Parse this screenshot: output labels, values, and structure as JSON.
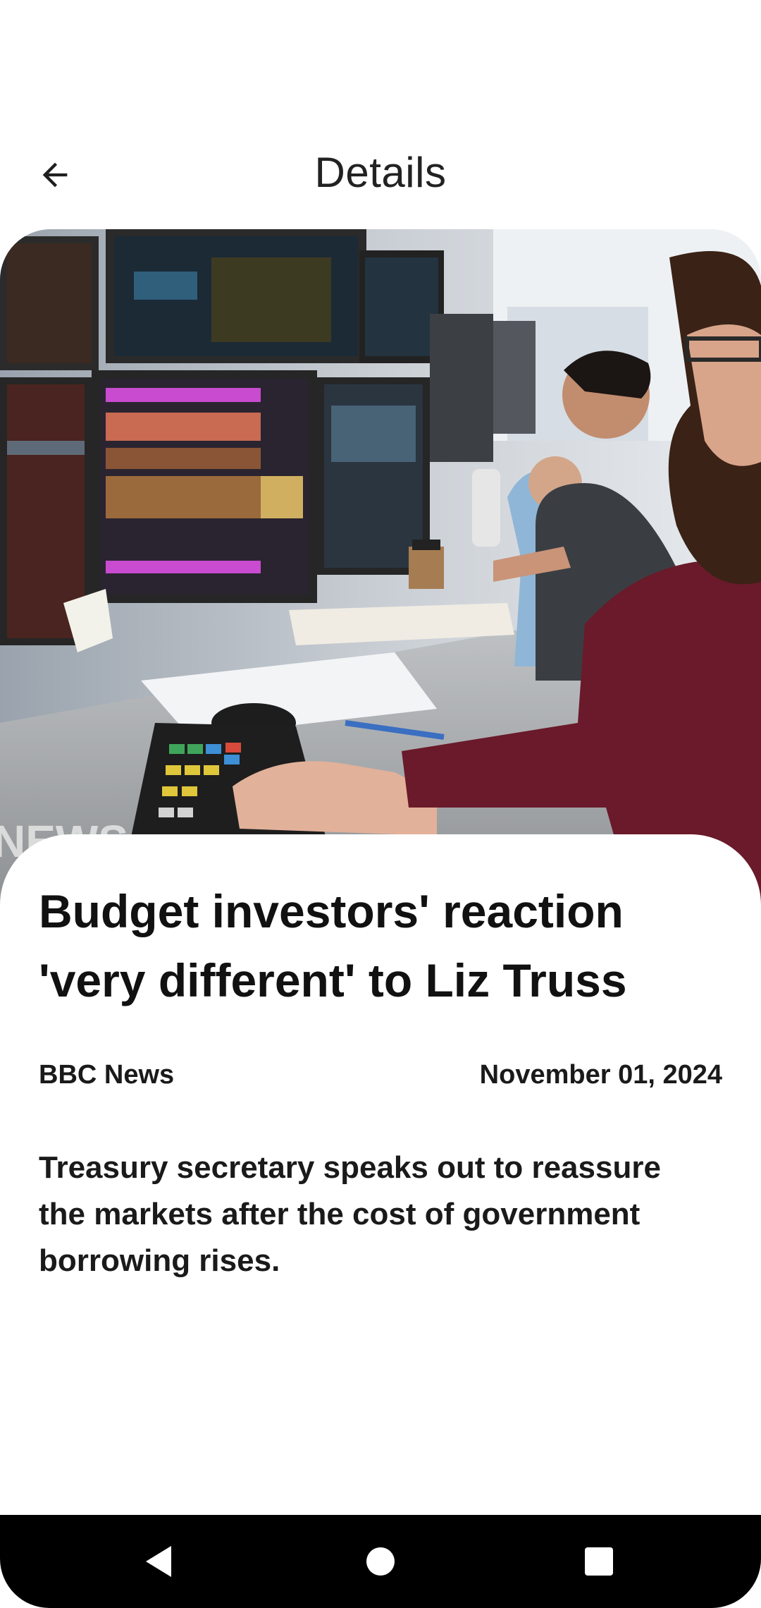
{
  "app_bar": {
    "title": "Details",
    "back_icon": "arrow-back-icon"
  },
  "hero_image": {
    "description_icon": "news-photo",
    "watermark": "NEWS"
  },
  "article": {
    "headline": "Budget investors' reaction 'very different' to Liz Truss",
    "source": "BBC News",
    "date": "November 01, 2024",
    "summary": "Treasury secretary speaks out to reassure the markets after the cost of government borrowing rises."
  },
  "system_nav": {
    "back_icon": "nav-back-icon",
    "home_icon": "nav-home-icon",
    "recents_icon": "nav-recents-icon"
  },
  "colors": {
    "background": "#ffffff",
    "text": "#111111",
    "nav_bar": "#000000"
  }
}
